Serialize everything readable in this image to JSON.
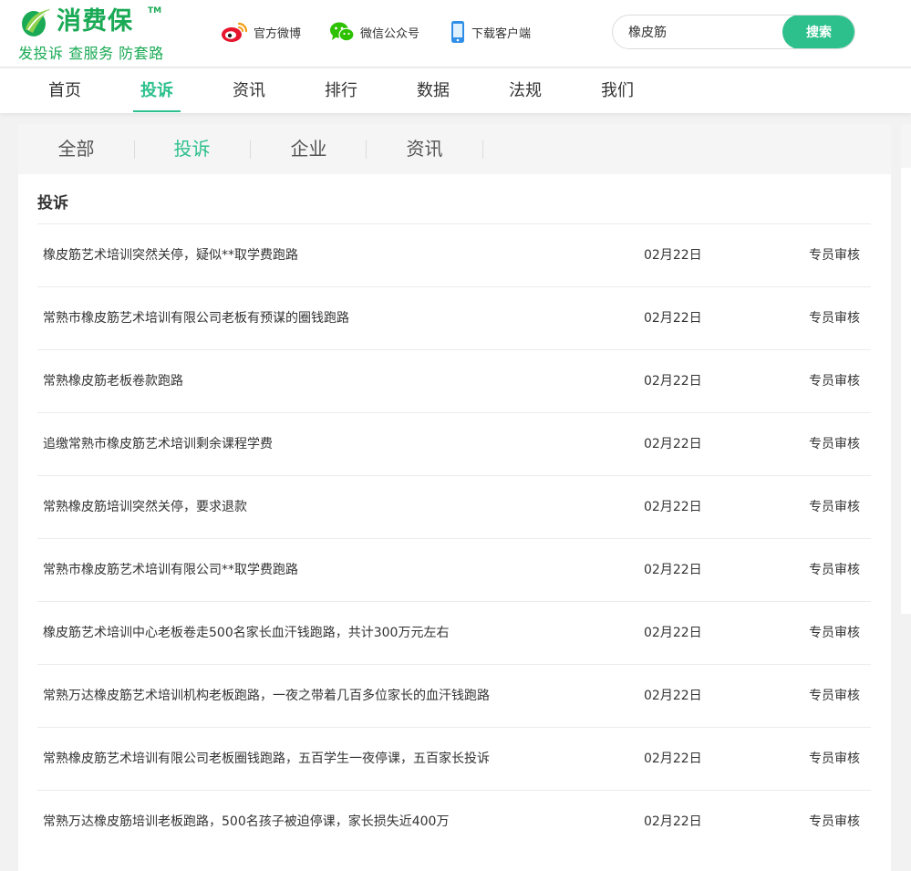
{
  "brand": {
    "name": "消费保",
    "trademark": "TM",
    "slogan": "发投诉 查服务 防套路",
    "color": "#1aaa55",
    "accent": "#2dc08d"
  },
  "header_links": [
    {
      "label": "官方微博",
      "icon": "weibo-icon"
    },
    {
      "label": "微信公众号",
      "icon": "wechat-icon"
    },
    {
      "label": "下载客户端",
      "icon": "mobile-phone-icon"
    }
  ],
  "search": {
    "value": "橡皮筋",
    "button_label": "搜索"
  },
  "nav": {
    "items": [
      "首页",
      "投诉",
      "资讯",
      "排行",
      "数据",
      "法规",
      "我们"
    ],
    "active": "投诉"
  },
  "subtabs": {
    "items": [
      "全部",
      "投诉",
      "企业",
      "资讯"
    ],
    "active": "投诉"
  },
  "section": {
    "title": "投诉"
  },
  "complaints": [
    {
      "title": "橡皮筋艺术培训突然关停，疑似**取学费跑路",
      "date": "02月22日",
      "status": "专员审核"
    },
    {
      "title": "常熟市橡皮筋艺术培训有限公司老板有预谋的圈钱跑路",
      "date": "02月22日",
      "status": "专员审核"
    },
    {
      "title": "常熟橡皮筋老板卷款跑路",
      "date": "02月22日",
      "status": "专员审核"
    },
    {
      "title": "追缴常熟市橡皮筋艺术培训剩余课程学费",
      "date": "02月22日",
      "status": "专员审核"
    },
    {
      "title": "常熟橡皮筋培训突然关停，要求退款",
      "date": "02月22日",
      "status": "专员审核"
    },
    {
      "title": "常熟市橡皮筋艺术培训有限公司**取学费跑路",
      "date": "02月22日",
      "status": "专员审核"
    },
    {
      "title": "橡皮筋艺术培训中心老板卷走500名家长血汗钱跑路，共计300万元左右",
      "date": "02月22日",
      "status": "专员审核"
    },
    {
      "title": "常熟万达橡皮筋艺术培训机构老板跑路，一夜之带着几百多位家长的血汗钱跑路",
      "date": "02月22日",
      "status": "专员审核"
    },
    {
      "title": "常熟橡皮筋艺术培训有限公司老板圈钱跑路，五百学生一夜停课，五百家长投诉",
      "date": "02月22日",
      "status": "专员审核"
    },
    {
      "title": "常熟万达橡皮筋培训老板跑路，500名孩子被迫停课，家长损失近400万",
      "date": "02月22日",
      "status": "专员审核"
    }
  ]
}
